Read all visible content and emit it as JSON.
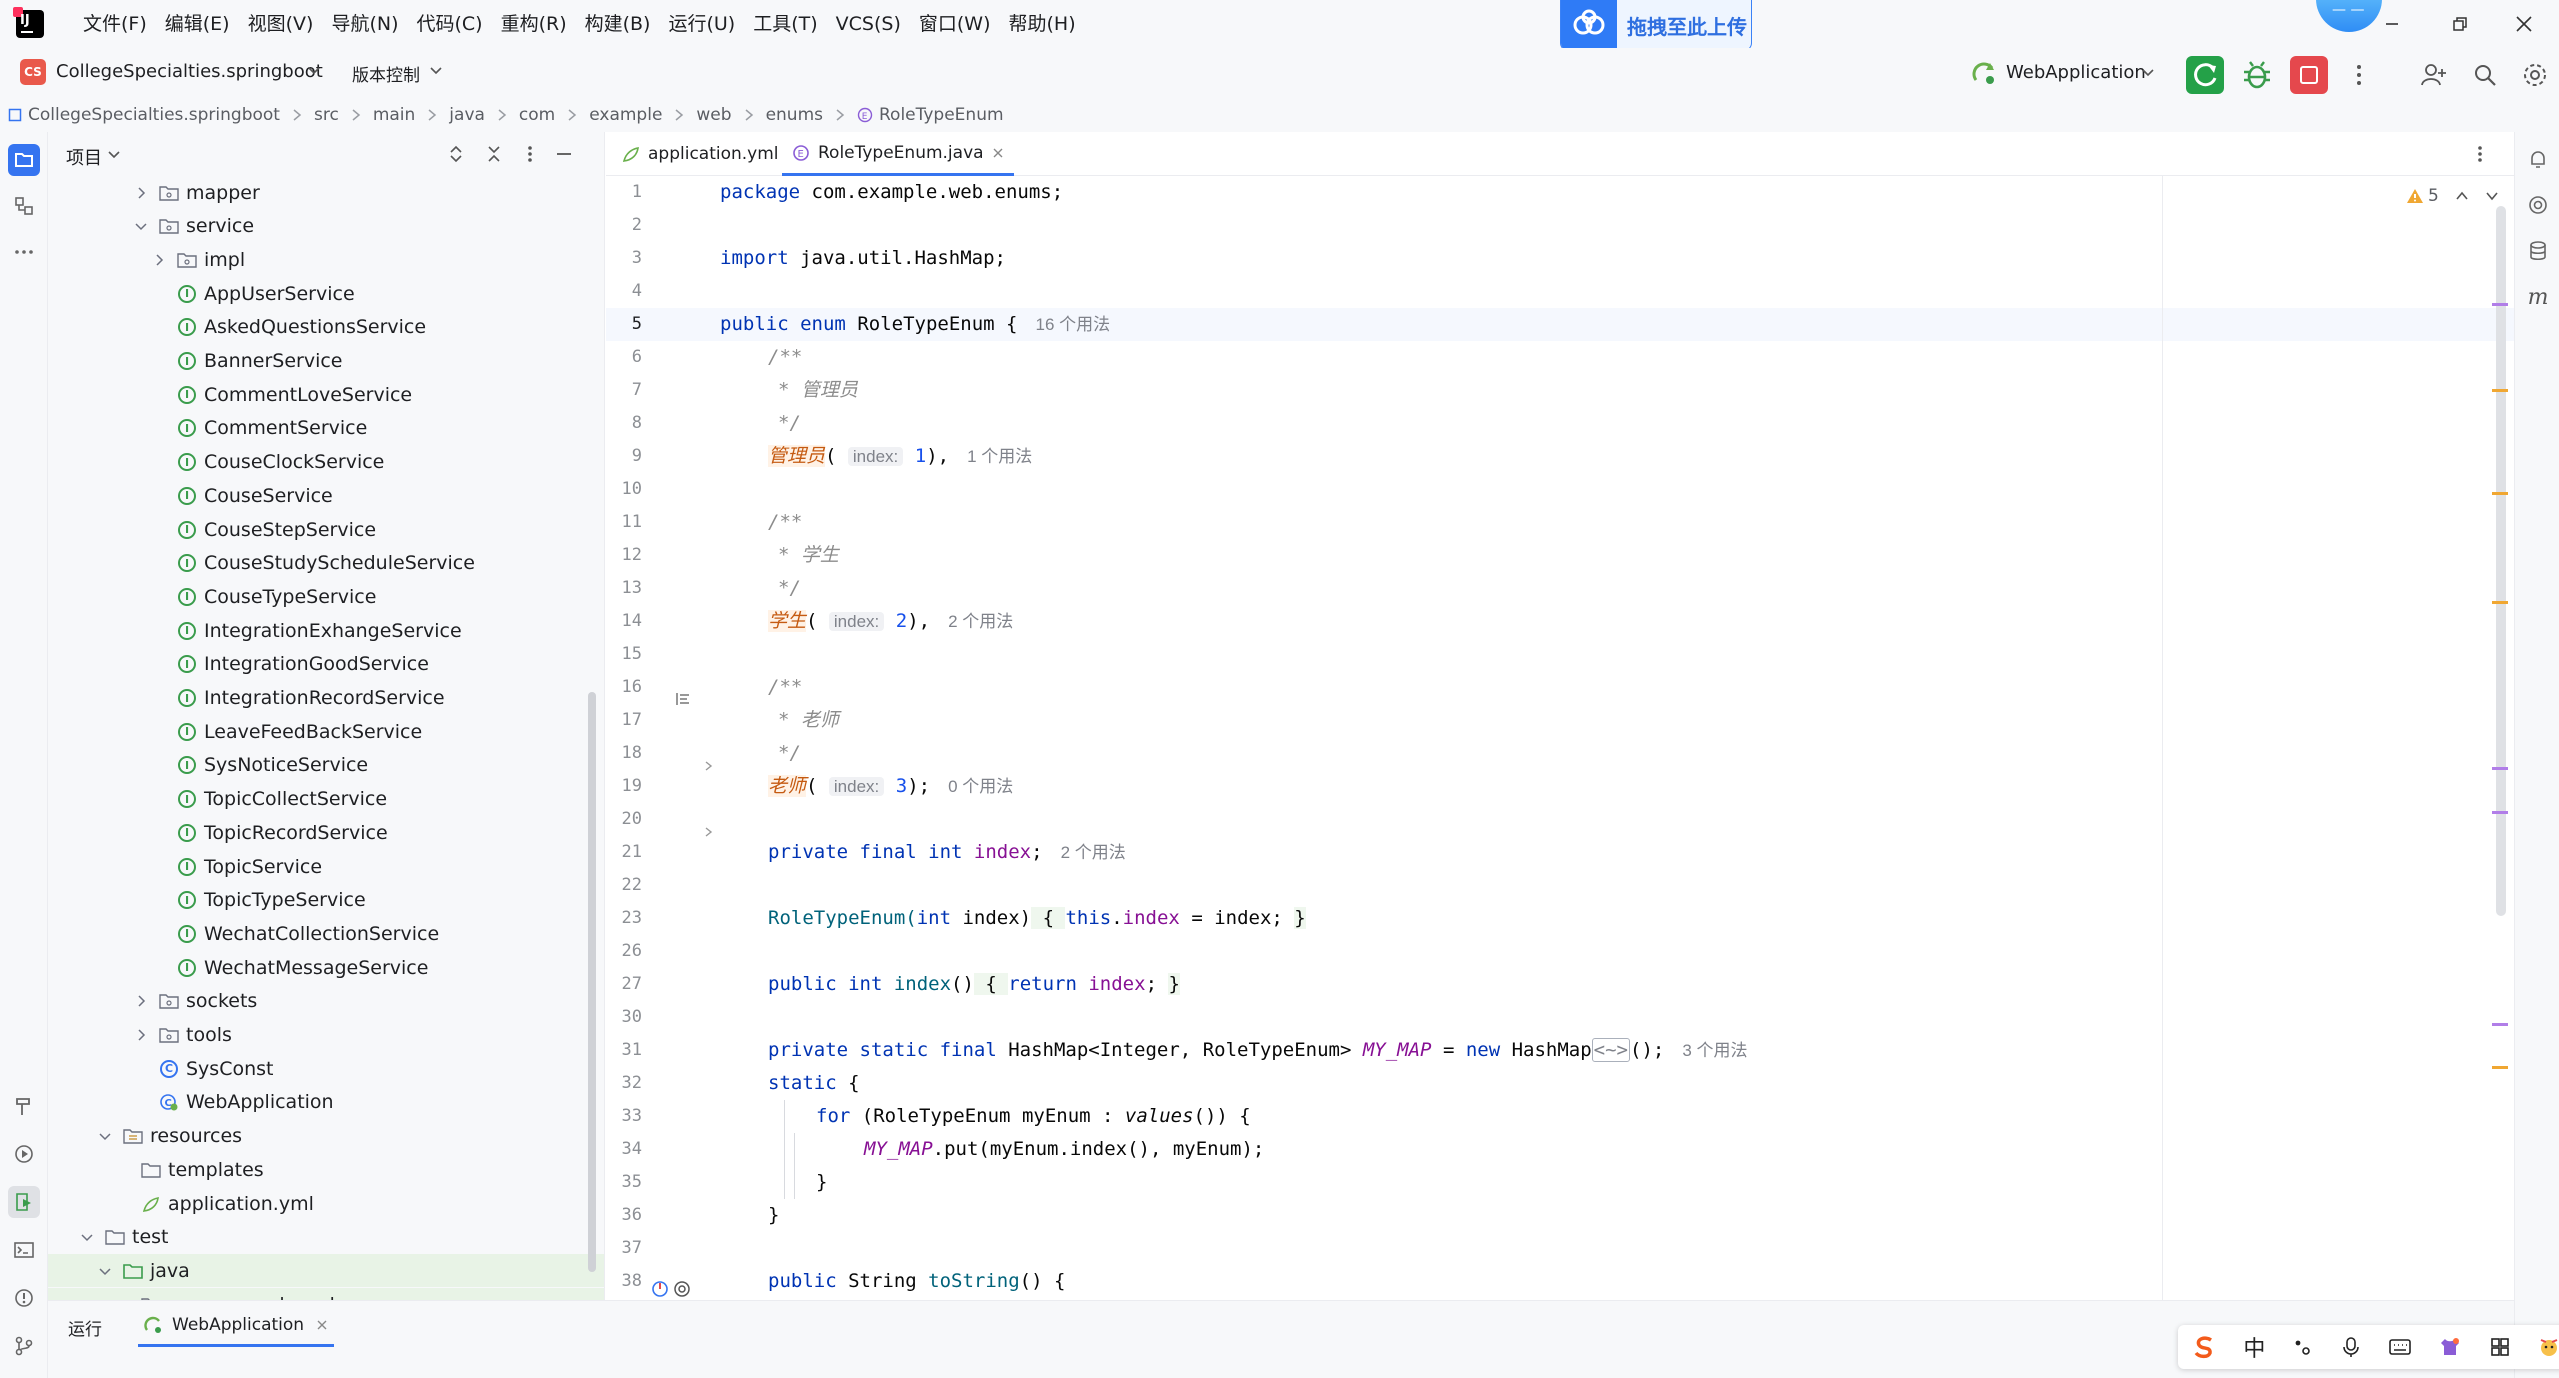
{
  "menu": [
    "文件(F)",
    "编辑(E)",
    "视图(V)",
    "导航(N)",
    "代码(C)",
    "重构(R)",
    "构建(B)",
    "运行(U)",
    "工具(T)",
    "VCS(S)",
    "窗口(W)",
    "帮助(H)"
  ],
  "upload": {
    "label": "拖拽至此上传"
  },
  "toolbar": {
    "project_badge": "CS",
    "project_name": "CollegeSpecialties.springboot",
    "vcs_label": "版本控制",
    "run_config": "WebApplication"
  },
  "breadcrumb": [
    "CollegeSpecialties.springboot",
    "src",
    "main",
    "java",
    "com",
    "example",
    "web",
    "enums",
    "RoleTypeEnum"
  ],
  "panel": {
    "title": "项目"
  },
  "tree": [
    {
      "label": "mapper",
      "indent": 3,
      "icon": "package",
      "chev": "right"
    },
    {
      "label": "service",
      "indent": 3,
      "icon": "package",
      "chev": "down"
    },
    {
      "label": "impl",
      "indent": 4,
      "icon": "package",
      "chev": "right"
    },
    {
      "label": "AppUserService",
      "indent": 4,
      "icon": "interface"
    },
    {
      "label": "AskedQuestionsService",
      "indent": 4,
      "icon": "interface"
    },
    {
      "label": "BannerService",
      "indent": 4,
      "icon": "interface"
    },
    {
      "label": "CommentLoveService",
      "indent": 4,
      "icon": "interface"
    },
    {
      "label": "CommentService",
      "indent": 4,
      "icon": "interface"
    },
    {
      "label": "CouseClockService",
      "indent": 4,
      "icon": "interface"
    },
    {
      "label": "CouseService",
      "indent": 4,
      "icon": "interface"
    },
    {
      "label": "CouseStepService",
      "indent": 4,
      "icon": "interface"
    },
    {
      "label": "CouseStudyScheduleService",
      "indent": 4,
      "icon": "interface"
    },
    {
      "label": "CouseTypeService",
      "indent": 4,
      "icon": "interface"
    },
    {
      "label": "IntegrationExhangeService",
      "indent": 4,
      "icon": "interface"
    },
    {
      "label": "IntegrationGoodService",
      "indent": 4,
      "icon": "interface"
    },
    {
      "label": "IntegrationRecordService",
      "indent": 4,
      "icon": "interface"
    },
    {
      "label": "LeaveFeedBackService",
      "indent": 4,
      "icon": "interface"
    },
    {
      "label": "SysNoticeService",
      "indent": 4,
      "icon": "interface"
    },
    {
      "label": "TopicCollectService",
      "indent": 4,
      "icon": "interface"
    },
    {
      "label": "TopicRecordService",
      "indent": 4,
      "icon": "interface"
    },
    {
      "label": "TopicService",
      "indent": 4,
      "icon": "interface"
    },
    {
      "label": "TopicTypeService",
      "indent": 4,
      "icon": "interface"
    },
    {
      "label": "WechatCollectionService",
      "indent": 4,
      "icon": "interface"
    },
    {
      "label": "WechatMessageService",
      "indent": 4,
      "icon": "interface"
    },
    {
      "label": "sockets",
      "indent": 3,
      "icon": "package",
      "chev": "right"
    },
    {
      "label": "tools",
      "indent": 3,
      "icon": "package",
      "chev": "right"
    },
    {
      "label": "SysConst",
      "indent": 3,
      "icon": "class"
    },
    {
      "label": "WebApplication",
      "indent": 3,
      "icon": "springboot"
    },
    {
      "label": "resources",
      "indent": 1,
      "icon": "resources",
      "chev": "down"
    },
    {
      "label": "templates",
      "indent": 2,
      "icon": "folder"
    },
    {
      "label": "application.yml",
      "indent": 2,
      "icon": "yml"
    },
    {
      "label": "test",
      "indent": 0,
      "icon": "folder",
      "chev": "down"
    },
    {
      "label": "java",
      "indent": 1,
      "icon": "folder-green",
      "chev": "down",
      "selected": true
    },
    {
      "label": "com.example.web",
      "indent": 2,
      "icon": "package",
      "chev": "down",
      "selected": true
    }
  ],
  "tabs": [
    {
      "label": "application.yml",
      "icon": "yml"
    },
    {
      "label": "RoleTypeEnum.java",
      "icon": "enum",
      "active": true
    }
  ],
  "inspection": {
    "warnings": "5"
  },
  "code": {
    "l1": {
      "kw": "package",
      "rest": " com.example.web.enums;"
    },
    "l3": {
      "kw": "import",
      "rest": " java.util.HashMap;"
    },
    "l5": {
      "kw1": "public",
      "kw2": "enum",
      "name": "RoleTypeEnum",
      "brace": " {",
      "usages": "16 个用法"
    },
    "doc_open": "/**",
    "doc_close": "*/",
    "c_admin": "* 管理员",
    "c_student": "* 学生",
    "c_teacher": "* 老师",
    "e_admin": "管理员",
    "e_student": "学生",
    "e_teacher": "老师",
    "hint_index": "index:",
    "v1": "1",
    "v2": "2",
    "v3": "3",
    "u_admin": "1 个用法",
    "u_student": "2 个用法",
    "u_teacher": "0 个用法",
    "l21": {
      "kw": "private final int",
      "field": "index",
      "usages": "2 个用法"
    },
    "l23": {
      "ctor": "RoleTypeEnum(",
      "kw": "int",
      "rest": " index)",
      "b1": " { ",
      "this": "this",
      "dot": ".",
      "field": "index",
      "assign": " = index; ",
      "b2": "}"
    },
    "l27": {
      "kw": "public int",
      "meth": "index",
      "paren": "()",
      "b1": " { ",
      "ret": "return",
      "field": "index",
      "semi": "; ",
      "b2": "}"
    },
    "l31": {
      "kw": "private static final",
      "type": " HashMap<Integer, ",
      "etype": "RoleTypeEnum",
      "gt": "> ",
      "field": "MY_MAP",
      "eq": " = ",
      "new": "new",
      "cls": " HashMap",
      "diamond": "<~>",
      "end": "();",
      "usages": "3 个用法"
    },
    "l32": {
      "kw": "static",
      "rest": " {"
    },
    "l33": {
      "kw": "for",
      "p1": " (",
      "etype": "RoleTypeEnum",
      "var": " myEnum : ",
      "call": "values",
      "end": "()) {"
    },
    "l34": {
      "field": "MY_MAP",
      "rest": ".put(myEnum.index(), myEnum);"
    },
    "l35": "}",
    "l36": "}",
    "l38": {
      "kw": "public",
      "type": " String ",
      "meth": "toString",
      "end": "() {"
    }
  },
  "line_numbers": [
    "1",
    "2",
    "3",
    "4",
    "5",
    "6",
    "7",
    "8",
    "9",
    "10",
    "11",
    "12",
    "13",
    "14",
    "15",
    "16",
    "17",
    "18",
    "19",
    "20",
    "21",
    "22",
    "23",
    "26",
    "27",
    "30",
    "31",
    "32",
    "33",
    "34",
    "35",
    "36",
    "37",
    "38"
  ],
  "bottom": {
    "run_label": "运行",
    "run_tab": "WebApplication"
  },
  "ime": [
    "中"
  ]
}
